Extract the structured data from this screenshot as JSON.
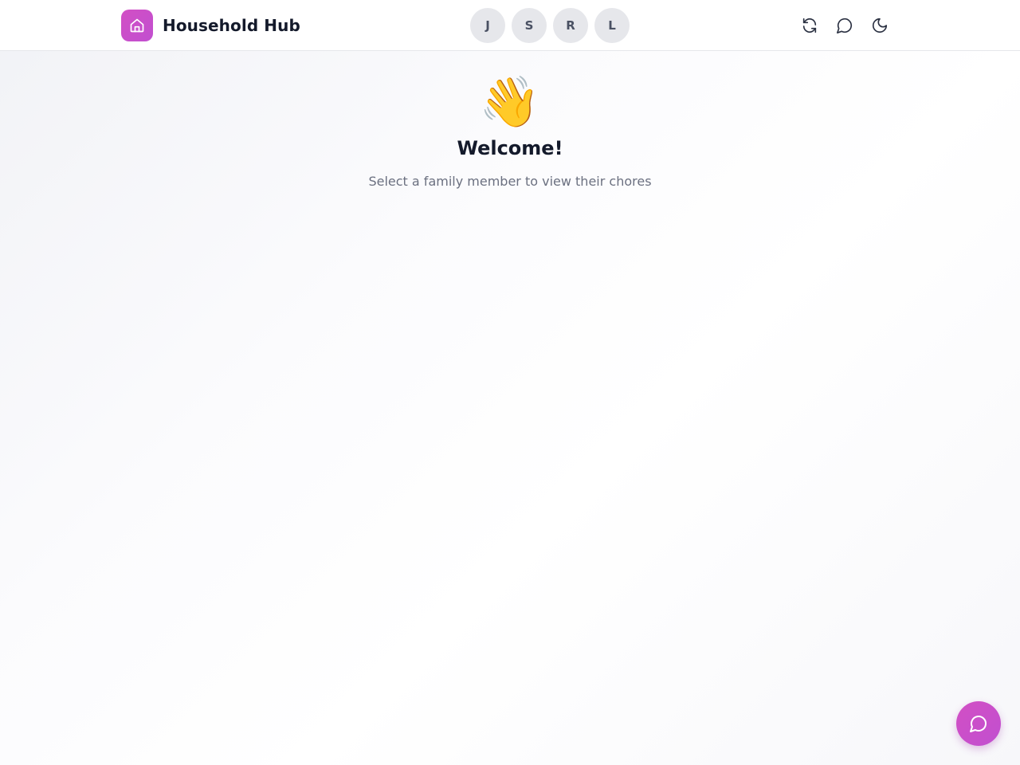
{
  "header": {
    "title": "Household Hub",
    "brand_icon": "home-icon",
    "accent_color": "#cc4fc8"
  },
  "members": [
    {
      "initial": "J"
    },
    {
      "initial": "S"
    },
    {
      "initial": "R"
    },
    {
      "initial": "L"
    }
  ],
  "actions": [
    {
      "icon": "refresh-icon"
    },
    {
      "icon": "chat-icon"
    },
    {
      "icon": "moon-icon"
    }
  ],
  "welcome": {
    "emoji": "👋",
    "title": "Welcome!",
    "subtitle": "Select a family member to view their chores"
  },
  "fab": {
    "icon": "chat-icon"
  }
}
